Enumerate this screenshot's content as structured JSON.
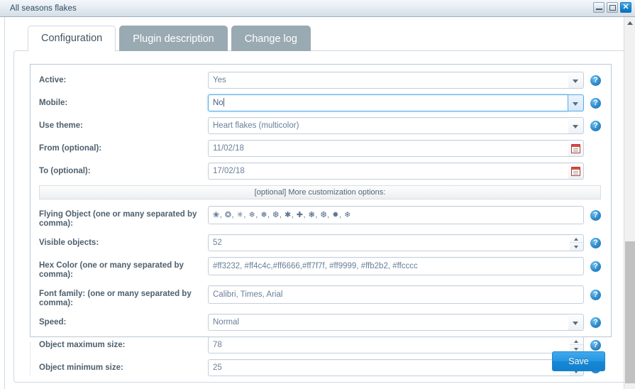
{
  "window": {
    "title": "All seasons flakes",
    "buttons": {
      "minimize": "minimize",
      "maximize": "maximize",
      "close": "✕"
    }
  },
  "tabs": [
    {
      "label": "Configuration",
      "active": true
    },
    {
      "label": "Plugin description",
      "active": false
    },
    {
      "label": "Change log",
      "active": false
    }
  ],
  "separator": {
    "text": "[optional] More customization options:"
  },
  "help_icon": "?",
  "form": {
    "fields": [
      {
        "label": "Active:",
        "value": "Yes",
        "control": "select",
        "focused": false,
        "help": true
      },
      {
        "label": "Mobile:",
        "value": "No",
        "control": "select",
        "focused": true,
        "help": true
      },
      {
        "label": "Use theme:",
        "value": "Heart flakes (multicolor)",
        "control": "select",
        "focused": false,
        "help": true
      },
      {
        "label": "From (optional):",
        "value": "11/02/18",
        "control": "date",
        "focused": false,
        "help": false
      },
      {
        "label": "To (optional):",
        "value": "17/02/18",
        "control": "date",
        "focused": false,
        "help": false
      }
    ],
    "fields2": [
      {
        "label": "Flying Object (one or many separated by comma):",
        "value": "❀, ❂, ✳, ❄, ❅, ❆, ✱, ✚, ❃, ❆, ✹, ❄",
        "control": "text",
        "focused": false,
        "help": true,
        "glyphs": true
      },
      {
        "label": "Visible objects:",
        "value": "52",
        "control": "spinner",
        "focused": false,
        "help": true
      },
      {
        "label": "Hex Color (one or many separated by comma):",
        "value": "#ff3232, #ff4c4c,#ff6666,#ff7f7f, #ff9999, #ffb2b2, #ffcccc",
        "control": "text",
        "focused": false,
        "help": true
      },
      {
        "label": "Font family: (one or many separated by comma):",
        "value": "Calibri, Times, Arial",
        "control": "text",
        "focused": false,
        "help": true
      },
      {
        "label": "Speed:",
        "value": "Normal",
        "control": "select",
        "focused": false,
        "help": true
      },
      {
        "label": "Object maximum size:",
        "value": "78",
        "control": "spinner",
        "focused": false,
        "help": true
      },
      {
        "label": "Object minimum size:",
        "value": "25",
        "control": "spinner",
        "focused": false,
        "help": true
      }
    ]
  },
  "footer": {
    "save_label": "Save"
  },
  "colors": {
    "accent": "#1e90d8",
    "tab_inactive": "#9aaab3",
    "field_text": "#69809a",
    "label_text": "#4e5f6d",
    "focus_border": "#54a9e8"
  }
}
